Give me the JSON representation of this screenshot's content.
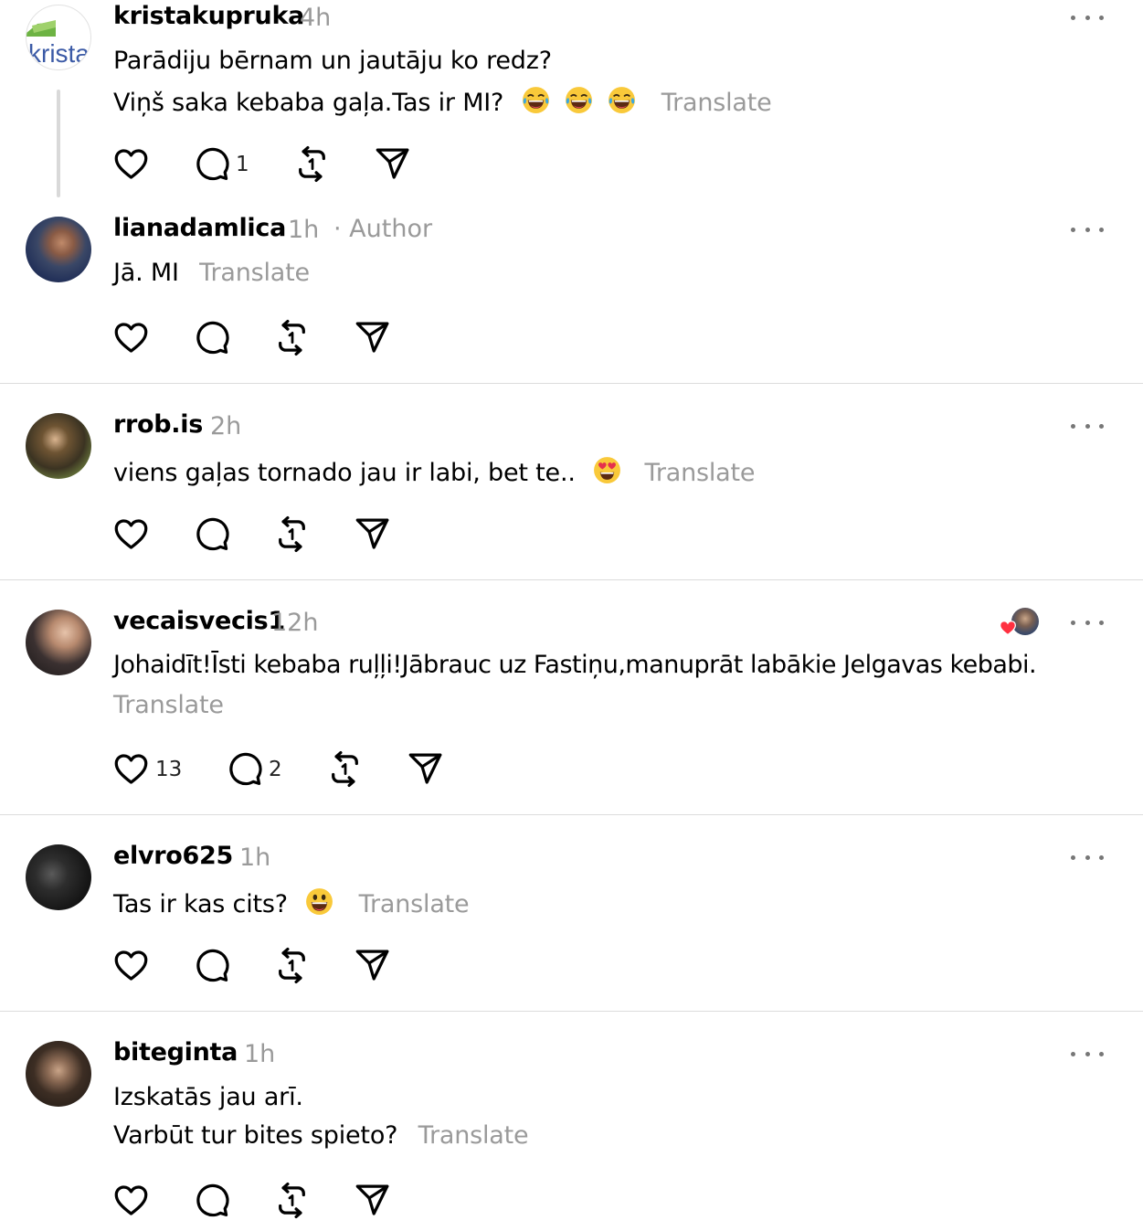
{
  "posts": [
    {
      "username": "kristakupruka",
      "time": "4h",
      "avatar_text": "krista",
      "lines": [
        "Parādiju bērnam un jautāju ko redz?",
        "Viņš saka kebaba gaļa.Tas ir MI?"
      ],
      "translate": "Translate",
      "reply_count": "1"
    },
    {
      "username": "lianadamlica",
      "time": "1h",
      "badge": "· Author",
      "lines": [
        "Jā. MI"
      ],
      "translate": "Translate"
    },
    {
      "username": "rrob.is",
      "time": "2h",
      "lines": [
        "viens gaļas tornado jau ir labi, bet te.."
      ],
      "translate": "Translate"
    },
    {
      "username": "vecaisvecis1",
      "time": "12h",
      "lines": [
        "Johaidīt!Īsti kebaba ruļļi!Jābrauc uz Fastiņu,manuprāt labākie Jelgavas kebabi."
      ],
      "translate": "Translate",
      "like_count": "13",
      "reply_count": "2"
    },
    {
      "username": "elvro625",
      "time": "1h",
      "lines": [
        "Tas ir kas cits?"
      ],
      "translate": "Translate"
    },
    {
      "username": "biteginta",
      "time": "1h",
      "lines": [
        "Izskatās jau arī.",
        "Varbūt tur bites spieto?"
      ],
      "translate": "Translate"
    }
  ],
  "icons": {
    "like": "heart-icon",
    "reply": "comment-bubble-icon",
    "repost": "repost-icon",
    "share": "send-icon",
    "more": "more-horizontal-icon"
  },
  "colors": {
    "secondary_text": "#9a9a9a",
    "divider": "#dcdcdc",
    "heart_red": "#ff3040"
  }
}
